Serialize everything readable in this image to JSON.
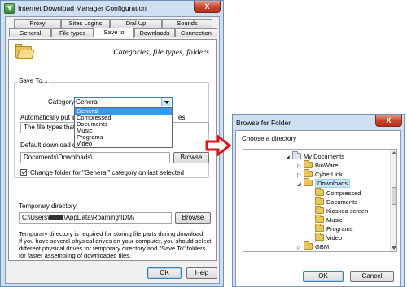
{
  "idm": {
    "title": "Internet Download Manager Configuration",
    "close": "X",
    "tabs_row1": [
      "Proxy",
      "Sites Logins",
      "Dial Up",
      "Sounds"
    ],
    "tabs_row2": [
      "General",
      "File types",
      "Save to",
      "Downloads",
      "Connection"
    ],
    "active_tab": "Save to",
    "header_title": "Categories, file types, folders",
    "save_to_legend": "Save To...",
    "category_label": "Category",
    "category_selected": "General",
    "category_options": [
      "General",
      "Compressed",
      "Documents",
      "Music",
      "Programs",
      "Video"
    ],
    "auto_put_label_left": "Automatically put in",
    "auto_put_label_right": "es:",
    "file_types_value": "The file types that a",
    "default_dir_label": "Default download di",
    "default_dir_value": "Documents\\Downloads\\",
    "browse_label": "Browse",
    "checkbox_label": "Change folder for \"General\" category on last selected",
    "checkbox_checked": true,
    "temp_dir_label": "Temporary directory",
    "temp_dir_value": "C:\\Users\\",
    "temp_dir_value_rest": "\\AppData\\Roaming\\IDM\\",
    "temp_browse_label": "Browse",
    "info_text": "Temporary directory is required for storing file parts during download.\nIf you have several physical drives on your computer, you should select different physical drives for temporary directory and \"Save To\" folders for faster assembling of downloaded files.",
    "ok_label": "OK",
    "help_label": "Help"
  },
  "browse": {
    "title": "Browse for Folder",
    "close": "X",
    "prompt": "Choose a directory",
    "tree": [
      {
        "label": "My Documents",
        "level": 0,
        "expand": "◢",
        "icon": "documents-folder-icon"
      },
      {
        "label": "BioWare",
        "level": 1,
        "expand": "▷",
        "icon": "folder-icon"
      },
      {
        "label": "CyberLink",
        "level": 1,
        "expand": "▷",
        "icon": "folder-icon"
      },
      {
        "label": "Downloads",
        "level": 1,
        "expand": "◢",
        "icon": "folder-icon",
        "selected": true
      },
      {
        "label": "Compressed",
        "level": 2,
        "expand": "",
        "icon": "folder-icon"
      },
      {
        "label": "Documents",
        "level": 2,
        "expand": "",
        "icon": "folder-icon"
      },
      {
        "label": "Kioskea screen",
        "level": 2,
        "expand": "",
        "icon": "folder-icon"
      },
      {
        "label": "Music",
        "level": 2,
        "expand": "",
        "icon": "folder-icon"
      },
      {
        "label": "Programs",
        "level": 2,
        "expand": "",
        "icon": "folder-icon"
      },
      {
        "label": "Video",
        "level": 2,
        "expand": "",
        "icon": "folder-icon"
      },
      {
        "label": "GBM",
        "level": 1,
        "expand": "▷",
        "icon": "folder-icon"
      }
    ],
    "ok_label": "OK",
    "cancel_label": "Cancel"
  },
  "colors": {
    "accent": "#3399ff",
    "arrow": "#e0141b",
    "window_frame": "#cfe0f3"
  }
}
